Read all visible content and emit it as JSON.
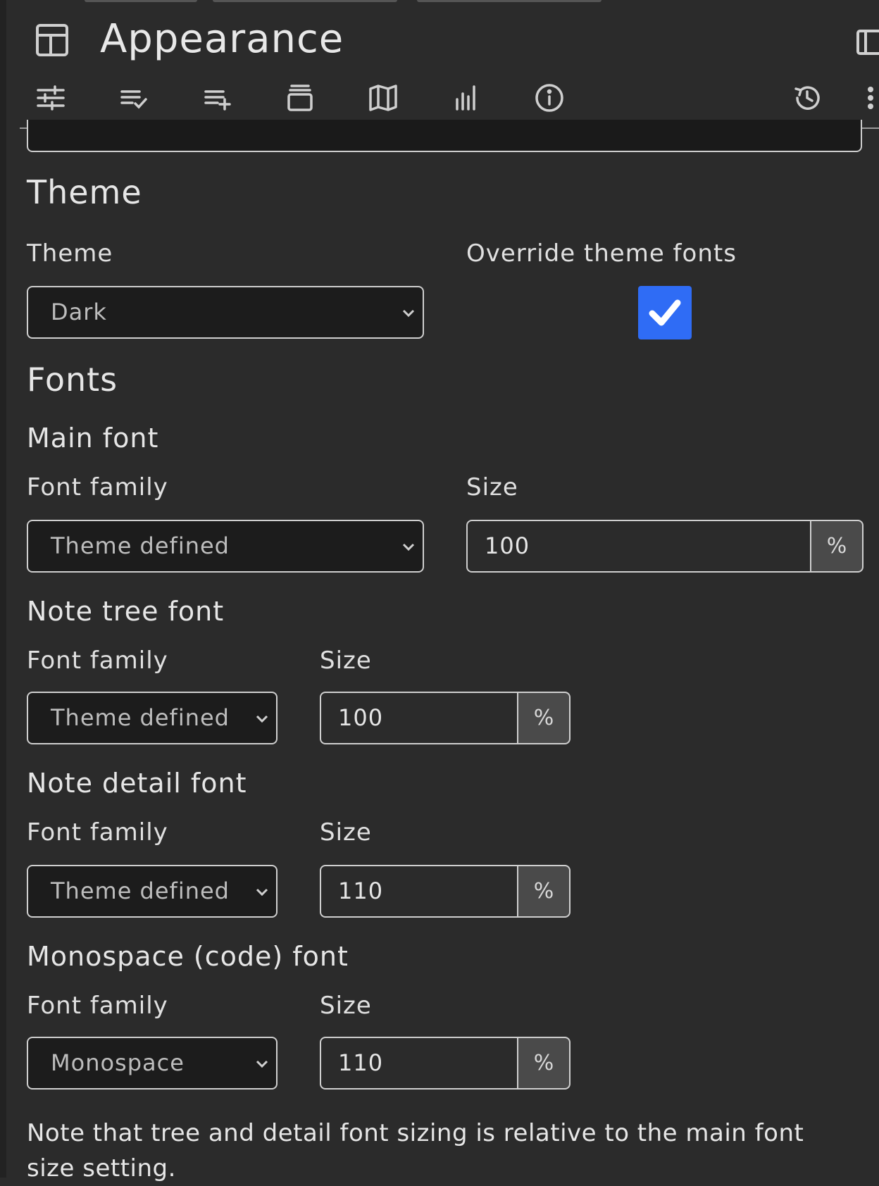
{
  "header": {
    "title": "Appearance"
  },
  "ribbon": [
    {
      "name": "ribbon-basic-properties",
      "icon": "sliders-icon"
    },
    {
      "name": "ribbon-owned-attributes",
      "icon": "list-check-icon"
    },
    {
      "name": "ribbon-inherited-attributes",
      "icon": "list-add-icon"
    },
    {
      "name": "ribbon-promoted-attributes",
      "icon": "stack-icon"
    },
    {
      "name": "ribbon-note-map",
      "icon": "map-icon"
    },
    {
      "name": "ribbon-similar-notes",
      "icon": "bar-chart-icon"
    },
    {
      "name": "ribbon-note-info",
      "icon": "info-icon"
    },
    {
      "name": "ribbon-revisions",
      "icon": "history-icon"
    },
    {
      "name": "ribbon-more",
      "icon": "more-vertical-icon"
    }
  ],
  "theme_section": {
    "heading": "Theme",
    "theme_label": "Theme",
    "theme_value": "Dark",
    "override_label": "Override theme fonts",
    "override_checked": true
  },
  "fonts_section": {
    "heading": "Fonts",
    "main": {
      "heading": "Main font",
      "family_label": "Font family",
      "family_value": "Theme defined",
      "size_label": "Size",
      "size_value": "100",
      "unit": "%"
    },
    "tree": {
      "heading": "Note tree font",
      "family_label": "Font family",
      "family_value": "Theme defined",
      "size_label": "Size",
      "size_value": "100",
      "unit": "%"
    },
    "detail": {
      "heading": "Note detail font",
      "family_label": "Font family",
      "family_value": "Theme defined",
      "size_label": "Size",
      "size_value": "110",
      "unit": "%"
    },
    "mono": {
      "heading": "Monospace (code) font",
      "family_label": "Font family",
      "family_value": "Monospace",
      "size_label": "Size",
      "size_value": "110",
      "unit": "%"
    },
    "footnote": "Note that tree and detail font sizing is relative to the main font size setting."
  },
  "colors": {
    "accent": "#2f6cf5",
    "background": "#2b2b2b",
    "input_background": "#1c1c1c"
  }
}
